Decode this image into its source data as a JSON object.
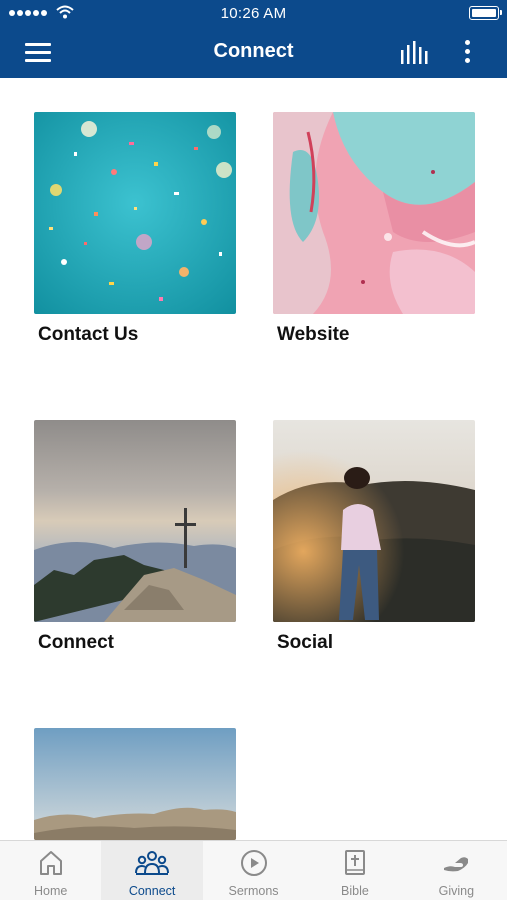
{
  "status_bar": {
    "time": "10:26 AM"
  },
  "header": {
    "title": "Connect"
  },
  "tiles": [
    {
      "label": "Contact Us",
      "image": "confetti-on-teal-photo"
    },
    {
      "label": "Website",
      "image": "pink-marble-paint-photo"
    },
    {
      "label": "Connect",
      "image": "mountain-cross-photo"
    },
    {
      "label": "Social",
      "image": "woman-mountain-sunset-photo"
    },
    {
      "label": "",
      "image": "desert-mountains-photo"
    }
  ],
  "tabs": [
    {
      "label": "Home",
      "icon": "home-icon"
    },
    {
      "label": "Connect",
      "icon": "people-icon"
    },
    {
      "label": "Sermons",
      "icon": "play-circle-icon"
    },
    {
      "label": "Bible",
      "icon": "bible-icon"
    },
    {
      "label": "Giving",
      "icon": "giving-hand-icon"
    }
  ],
  "colors": {
    "brand": "#0c4a8c",
    "tab_inactive": "#8a8a8a"
  }
}
